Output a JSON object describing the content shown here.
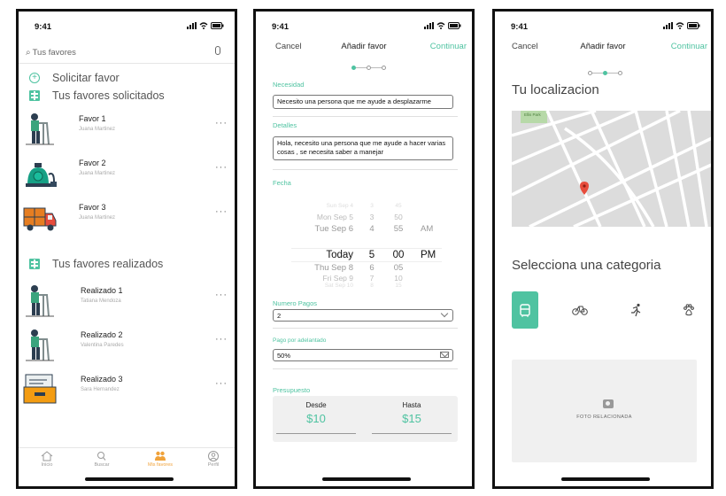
{
  "status": {
    "time": "9:41"
  },
  "screen1": {
    "search_placeholder": "Tus favores",
    "actions": {
      "request": "Solicitar favor",
      "requested": "Tus favores solicitados",
      "done": "Tus favores realizados"
    },
    "requested_items": [
      {
        "title": "Favor 1",
        "person": "Juana Martinez"
      },
      {
        "title": "Favor 2",
        "person": "Juana Martinez"
      },
      {
        "title": "Favor 3",
        "person": "Juana Martinez"
      }
    ],
    "done_items": [
      {
        "title": "Realizado 1",
        "person": "Tatiana Mendoza"
      },
      {
        "title": "Realizado 2",
        "person": "Valentina Paredes"
      },
      {
        "title": "Realizado 3",
        "person": "Sara Hernandez"
      }
    ],
    "tabs": [
      {
        "label": "Inicio",
        "icon": "home-icon"
      },
      {
        "label": "Buscar",
        "icon": "search-icon"
      },
      {
        "label": "Mis favores",
        "icon": "people-icon"
      },
      {
        "label": "Perfil",
        "icon": "profile-icon"
      }
    ],
    "more_label": "···"
  },
  "screen2": {
    "nav": {
      "cancel": "Cancel",
      "title": "Añadir favor",
      "continue": "Continuar"
    },
    "necesidad_label": "Necesidad",
    "necesidad_value": "Necesito una persona que me ayude a desplazarme",
    "detalles_label": "Detalles",
    "detalles_value": "Hola, necesito una persona que me ayude a hacer varias cosas , se necesita saber a manejar",
    "fecha_label": "Fecha",
    "picker_rows": [
      {
        "d": "Sun Sep 4",
        "h": "3",
        "m": "45",
        "ap": ""
      },
      {
        "d": "Mon Sep 5",
        "h": "3",
        "m": "50",
        "ap": ""
      },
      {
        "d": "Tue Sep 6",
        "h": "4",
        "m": "55",
        "ap": "AM"
      },
      {
        "d": "Today",
        "h": "5",
        "m": "00",
        "ap": "PM"
      },
      {
        "d": "Thu Sep 8",
        "h": "6",
        "m": "05",
        "ap": ""
      },
      {
        "d": "Fri Sep 9",
        "h": "7",
        "m": "10",
        "ap": ""
      },
      {
        "d": "Sat Sep 10",
        "h": "8",
        "m": "15",
        "ap": ""
      }
    ],
    "pagos_label": "Numero Pagos",
    "pagos_value": "2",
    "adelantado_label": "Pago por adelantado",
    "adelantado_value": "50%",
    "presupuesto_label": "Presupuesto",
    "desde_label": "Desde",
    "desde_value": "$10",
    "hasta_label": "Hasta",
    "hasta_value": "$15"
  },
  "screen3": {
    "nav": {
      "cancel": "Cancel",
      "title": "Añadir favor",
      "continue": "Continuar"
    },
    "location_title": "Tu localizacion",
    "map_park": "Ellis Park",
    "category_title": "Selecciona una categoria",
    "categories": [
      {
        "icon": "walker-icon",
        "selected": true
      },
      {
        "icon": "bicycle-icon",
        "selected": false
      },
      {
        "icon": "runner-icon",
        "selected": false
      },
      {
        "icon": "paw-icon",
        "selected": false
      }
    ],
    "photo_label": "FOTO RELACIONADA"
  },
  "colors": {
    "accent": "#4fc3a1",
    "active_tab": "#f0a23a"
  }
}
